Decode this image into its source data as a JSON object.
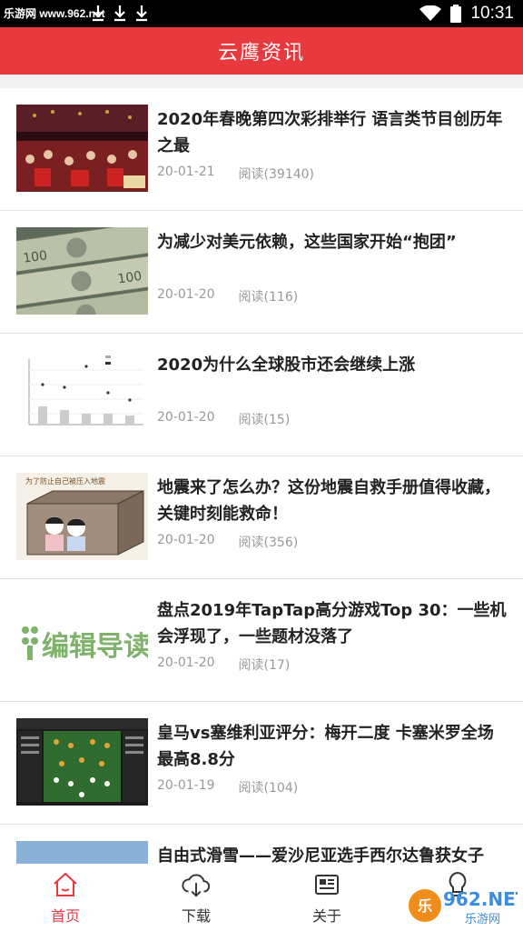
{
  "status_bar": {
    "site_logo": "乐游网 www.962.net",
    "time": "10:31",
    "icons": [
      "download-icon",
      "download-icon",
      "download-icon",
      "wifi-icon",
      "battery-icon"
    ]
  },
  "header": {
    "title": "云鹰资讯"
  },
  "articles": [
    {
      "title": "2020年春晚第四次彩排举行 语言类节目创历年之最",
      "date": "20-01-21",
      "reads": "阅读(39140)"
    },
    {
      "title": "为减少对美元依赖，这些国家开始“抱团”",
      "date": "20-01-20",
      "reads": "阅读(116)"
    },
    {
      "title": "2020为什么全球股市还会继续上涨",
      "date": "20-01-20",
      "reads": "阅读(15)"
    },
    {
      "title": "地震来了怎么办？这份地震自救手册值得收藏，关键时刻能救命！",
      "date": "20-01-20",
      "reads": "阅读(356)"
    },
    {
      "title": "盘点2019年TapTap高分游戏Top 30：一些机会浮现了，一些题材没落了",
      "date": "20-01-20",
      "reads": "阅读(17)"
    },
    {
      "title": "皇马vs塞维利亚评分：梅开二度 卡塞米罗全场最高8.8分",
      "date": "20-01-19",
      "reads": "阅读(104)"
    },
    {
      "title": "自由式滑雪——爱沙尼亚选手西尔达鲁获女子",
      "date": "",
      "reads": ""
    }
  ],
  "thumb_texts": {
    "editor": "编辑导读",
    "quake_caption": "为了防止自己被压入地震"
  },
  "bottom_nav": [
    {
      "label": "首页",
      "icon": "home-icon",
      "active": true
    },
    {
      "label": "下载",
      "icon": "cloud-download-icon",
      "active": false
    },
    {
      "label": "关于",
      "icon": "news-card-icon",
      "active": false
    },
    {
      "label": "",
      "icon": "lightbulb-icon",
      "active": false
    }
  ],
  "watermark": {
    "text": "962.NET",
    "sub": "乐游网"
  },
  "colors": {
    "accent": "#e8393f",
    "text": "#222222",
    "meta": "#999999"
  }
}
